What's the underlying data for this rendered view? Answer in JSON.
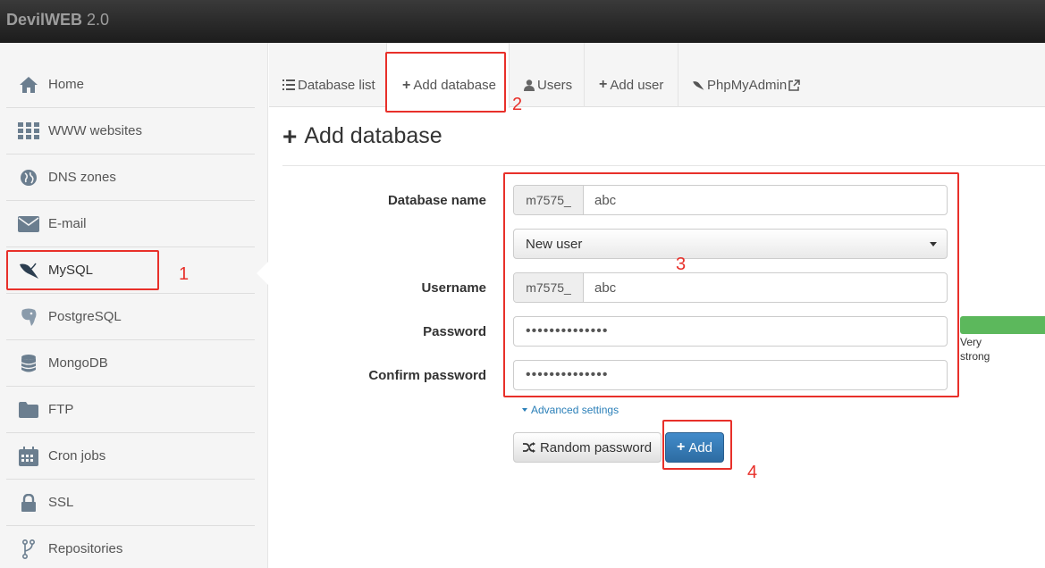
{
  "app": {
    "brand_bold": "DevilWEB",
    "brand_version": " 2.0"
  },
  "sidebar": {
    "items": [
      {
        "label": "Home",
        "icon": "home-icon"
      },
      {
        "label": "WWW websites",
        "icon": "grid-icon"
      },
      {
        "label": "DNS zones",
        "icon": "globe-icon"
      },
      {
        "label": "E-mail",
        "icon": "envelope-icon"
      },
      {
        "label": "MySQL",
        "icon": "mysql-dolphin-icon",
        "active": true
      },
      {
        "label": "PostgreSQL",
        "icon": "postgresql-elephant-icon"
      },
      {
        "label": "MongoDB",
        "icon": "database-icon"
      },
      {
        "label": "FTP",
        "icon": "folder-icon"
      },
      {
        "label": "Cron jobs",
        "icon": "calendar-icon"
      },
      {
        "label": "SSL",
        "icon": "lock-icon"
      },
      {
        "label": "Repositories",
        "icon": "fork-icon"
      }
    ]
  },
  "tabs": [
    {
      "label": "Database list",
      "icon": "list-icon"
    },
    {
      "label": "Add database",
      "icon": "plus-icon",
      "active": true
    },
    {
      "label": "Users",
      "icon": "user-icon"
    },
    {
      "label": "Add user",
      "icon": "plus-icon"
    },
    {
      "label": "PhpMyAdmin",
      "icon": "external-link-icon"
    }
  ],
  "page": {
    "title": "Add database"
  },
  "form": {
    "db_name_label": "Database name",
    "db_prefix": "m7575_",
    "db_name_value": "abc",
    "user_select": "New user",
    "username_label": "Username",
    "user_prefix": "m7575_",
    "username_value": "abc",
    "password_label": "Password",
    "password_value": "••••••••••••••",
    "confirm_label": "Confirm password",
    "confirm_value": "••••••••••••••",
    "strength_line1": "Very",
    "strength_line2": "strong",
    "advanced_label": "Advanced settings",
    "random_label": "Random password",
    "add_label": "Add"
  },
  "annotations": {
    "n1": "1",
    "n2": "2",
    "n3": "3",
    "n4": "4"
  },
  "colors": {
    "accent_blue": "#428bca",
    "annotation_red": "#e8302a",
    "strength_green": "#5cb85c"
  }
}
